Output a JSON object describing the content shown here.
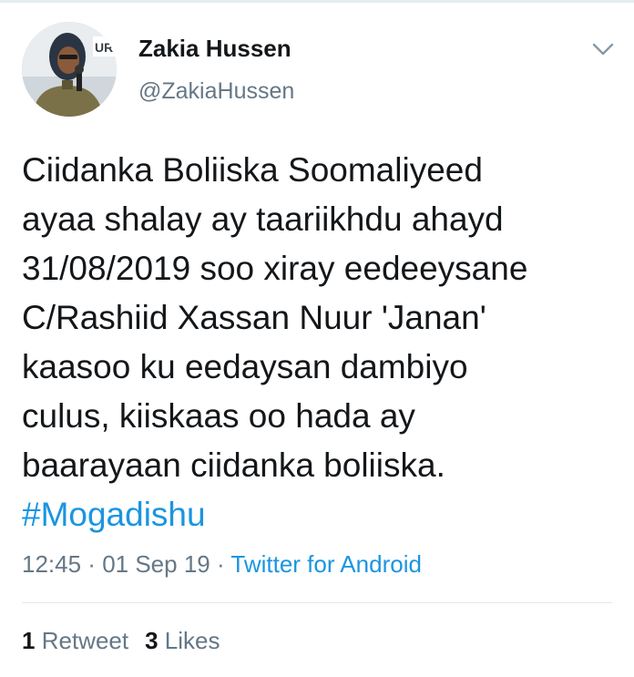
{
  "tweet": {
    "display_name": "Zakia Hussen",
    "handle": "@ZakiaHussen",
    "avatar_badge_text": "UR",
    "text_lines": [
      "Ciidanka Boliiska Soomaliyeed",
      "ayaa shalay ay taariikhdu ahayd",
      "31/08/2019 soo xiray eedeeysane",
      "C/Rashiid Xassan Nuur 'Janan'",
      "kaasoo ku eedaysan dambiyo",
      "culus, kiiskaas oo hada ay",
      "baarayaan ciidanka boliiska."
    ],
    "hashtag": "#Mogadishu",
    "time": "12:45",
    "separator": " · ",
    "date": "01 Sep 19",
    "source": "Twitter for Android",
    "retweet_count": "1",
    "retweet_label": "Retweet",
    "like_count": "3",
    "like_label": "Likes"
  },
  "colors": {
    "text": "#14171a",
    "secondary": "#657786",
    "link": "#1b95e0",
    "divider": "#e1e8ed"
  },
  "icons": {
    "menu": "chevron-down-icon"
  }
}
